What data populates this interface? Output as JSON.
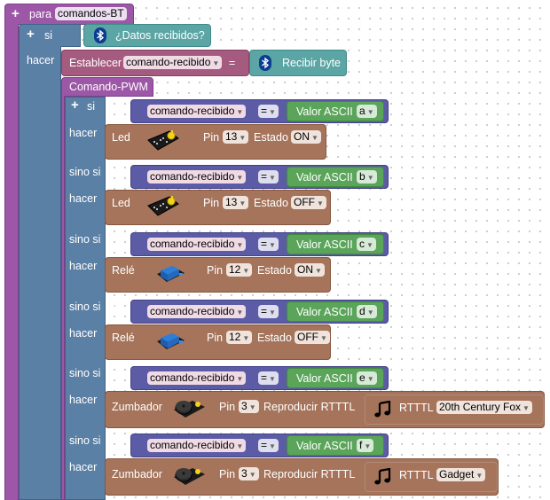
{
  "procedure": {
    "keyword": "para",
    "name": "comandos-BT"
  },
  "if_main": {
    "keyword": "si",
    "then": "hacer"
  },
  "condition": {
    "label": "¿Datos recibidos?"
  },
  "set_block": {
    "label": "Establecer",
    "variable": "comando-recibido",
    "equals": "=",
    "value": "Recibir byte"
  },
  "pwm_block": {
    "label": "Comando-PWM"
  },
  "compare": {
    "variable": "comando-recibido",
    "operator": "=",
    "ascii_label": "Valor ASCII"
  },
  "branches": [
    {
      "keyword": "si",
      "then": "hacer",
      "char": "a",
      "action": "Led",
      "pin_label": "Pin",
      "pin": "13",
      "mode_label": "Estado",
      "mode": "ON"
    },
    {
      "keyword": "sino si",
      "then": "hacer",
      "char": "b",
      "action": "Led",
      "pin_label": "Pin",
      "pin": "13",
      "mode_label": "Estado",
      "mode": "OFF"
    },
    {
      "keyword": "sino si",
      "then": "hacer",
      "char": "c",
      "action": "Relé",
      "pin_label": "Pin",
      "pin": "12",
      "mode_label": "Estado",
      "mode": "ON"
    },
    {
      "keyword": "sino si",
      "then": "hacer",
      "char": "d",
      "action": "Relé",
      "pin_label": "Pin",
      "pin": "12",
      "mode_label": "Estado",
      "mode": "OFF"
    },
    {
      "keyword": "sino si",
      "then": "hacer",
      "char": "e",
      "action": "Zumbador",
      "pin_label": "Pin",
      "pin": "3",
      "mode_label": "Reproducir RTTTL",
      "rtttl_label": "RTTTL",
      "rtttl": "20th Century Fox"
    },
    {
      "keyword": "sino si",
      "then": "hacer",
      "char": "f",
      "action": "Zumbador",
      "pin_label": "Pin",
      "pin": "3",
      "mode_label": "Reproducir RTTTL",
      "rtttl_label": "RTTTL",
      "rtttl": "Gadget"
    }
  ],
  "icons": {
    "plus": "plus-icon",
    "minus": "minus-icon",
    "bluetooth": "bluetooth-icon",
    "led": "led-module-icon",
    "relay": "relay-module-icon",
    "buzzer": "buzzer-module-icon",
    "note": "music-note-icon"
  },
  "colors": {
    "procedure": "#9c58a6",
    "control": "#5b80a5",
    "logic": "#5c5ca6",
    "math": "#5ba55b",
    "comm": "#5ba5a5",
    "actuator": "#a5745b",
    "variable": "#a55b80",
    "bluetooth": "#0a3d91"
  }
}
